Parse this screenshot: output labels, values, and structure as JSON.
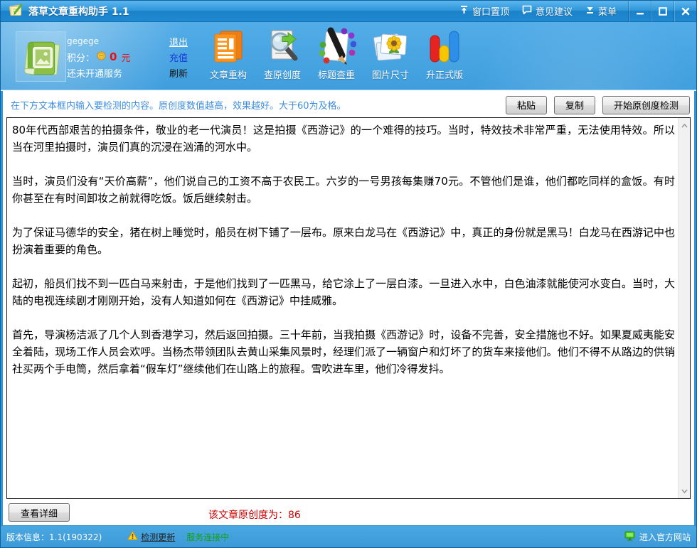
{
  "titlebar": {
    "title": "落草文章重构助手 1.1",
    "pin_label": "窗口置顶",
    "feedback_label": "意见建议",
    "menu_label": "菜单"
  },
  "account": {
    "username": "gegege",
    "points_label": "积分：",
    "points_value": "0",
    "points_unit": "元",
    "service_status": "还未开通服务",
    "logout_label": "退出",
    "recharge_label": "充值",
    "refresh_label": "刷新"
  },
  "toolbar": {
    "items": [
      {
        "label": "文章重构",
        "icon": "article-rebuild-icon"
      },
      {
        "label": "查原创度",
        "icon": "originality-check-icon"
      },
      {
        "label": "标题查重",
        "icon": "title-dedup-icon"
      },
      {
        "label": "图片尺寸",
        "icon": "image-size-icon"
      },
      {
        "label": "升正式版",
        "icon": "upgrade-icon"
      }
    ]
  },
  "main": {
    "instruction": "在下方文本框内输入要检测的内容。原创度数值越高，效果越好。大于60为及格。",
    "paste_label": "粘贴",
    "copy_label": "复制",
    "detect_label": "开始原创度检测",
    "paragraphs": [
      "80年代西部艰苦的拍摄条件，敬业的老一代演员！这是拍摄《西游记》的一个难得的技巧。当时，特效技术非常严重，无法使用特效。所以当在河里拍摄时，演员们真的沉浸在汹涌的河水中。",
      "当时，演员们没有“天价高薪”，他们说自己的工资不高于农民工。六岁的一号男孩每集赚70元。不管他们是谁，他们都吃同样的盒饭。有时你甚至在有时间卸妆之前就得吃饭。饭后继续射击。",
      "为了保证马德华的安全，猪在树上睡觉时，船员在树下铺了一层布。原来白龙马在《西游记》中，真正的身份就是黑马！白龙马在西游记中也扮演着重要的角色。",
      "起初，船员们找不到一匹白马来射击，于是他们找到了一匹黑马，给它涂上了一层白漆。一旦进入水中，白色油漆就能使河水变白。当时，大陆的电视连续剧才刚刚开始，没有人知道如何在《西游记》中挂威雅。",
      "首先，导演杨洁派了几个人到香港学习，然后返回拍摄。三十年前，当我拍摄《西游记》时，设备不完善，安全措施也不好。如果夏威夷能安全着陆，现场工作人员会欢呼。当杨杰带领团队去黄山采集风景时，经理们派了一辆窗户和灯坏了的货车来接他们。他们不得不从路边的供销社买两个手电筒，然后拿着“假车灯”继续他们在山路上的旅程。雪吹进车里，他们冷得发抖。"
    ],
    "detail_label": "查看详细",
    "result_label": "该文章原创度为：86"
  },
  "statusbar": {
    "version": "版本信息：1.1(190322)",
    "update_label": "检测更新",
    "connection_status": "服务连接中",
    "website_label": "进入官方网站"
  },
  "colors": {
    "titlebar_blue": "#1e88d0",
    "panel_blue": "#46a6e3",
    "instruction_blue": "#3e8ede",
    "points_red": "#e81111",
    "result_red": "#cc0000",
    "recharge_blue": "#1a39dd",
    "connected_green": "#12a312"
  }
}
